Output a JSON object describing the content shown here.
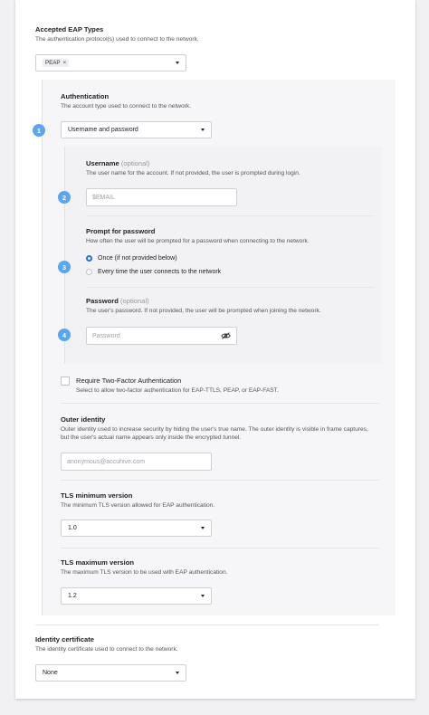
{
  "eap_types": {
    "label": "Accepted EAP Types",
    "description": "The authentication protocol(s) used to connect to the network.",
    "selected": [
      "PEAP"
    ],
    "remove_symbol": "×"
  },
  "authentication": {
    "label": "Authentication",
    "description": "The account type used to connect to the network.",
    "value": "Username and password",
    "step": "1"
  },
  "username": {
    "label": "Username",
    "optional": "(optional)",
    "description": "The user name for the account. If not provided, the user is prompted during login.",
    "placeholder": "$EMAIL",
    "step": "2"
  },
  "prompt": {
    "label": "Prompt for password",
    "description": "How often the user will be prompted for a password when connecting to the network.",
    "step": "3",
    "options": [
      {
        "label": "Once (if not provided below)",
        "selected": true
      },
      {
        "label": "Every time the user connects to the network",
        "selected": false
      }
    ]
  },
  "password": {
    "label": "Password",
    "optional": "(optional)",
    "description": "The user's password. If not provided, the user will be prompted when joining the network.",
    "placeholder": "Password",
    "step": "4",
    "visibility_icon": "eye-slash-icon"
  },
  "two_factor": {
    "label": "Require Two-Factor Authentication",
    "description": "Select to allow two-factor authentication for EAP-TTLS, PEAP, or EAP-FAST.",
    "checked": false
  },
  "outer_identity": {
    "label": "Outer identity",
    "description": "Outer identity used to increase security by hiding the user's true name. The outer identity is visible in frame captures, but the user's actual name appears only inside the encrypted tunnel.",
    "placeholder": "anonymous@accuhive.com"
  },
  "tls_min": {
    "label": "TLS minimum version",
    "description": "The minimum TLS version allowed for EAP authentication.",
    "value": "1.0"
  },
  "tls_max": {
    "label": "TLS maximum version",
    "description": "The maximum TLS version to be used with EAP authentication.",
    "value": "1.2"
  },
  "identity_certificate": {
    "label": "Identity certificate",
    "description": "The identity certificate used to connect to the network.",
    "value": "None"
  },
  "colors": {
    "step_badge": "#5aa6f0",
    "radio_selected": "#1f6fe0",
    "panel_bg": "#f6f6f8"
  }
}
